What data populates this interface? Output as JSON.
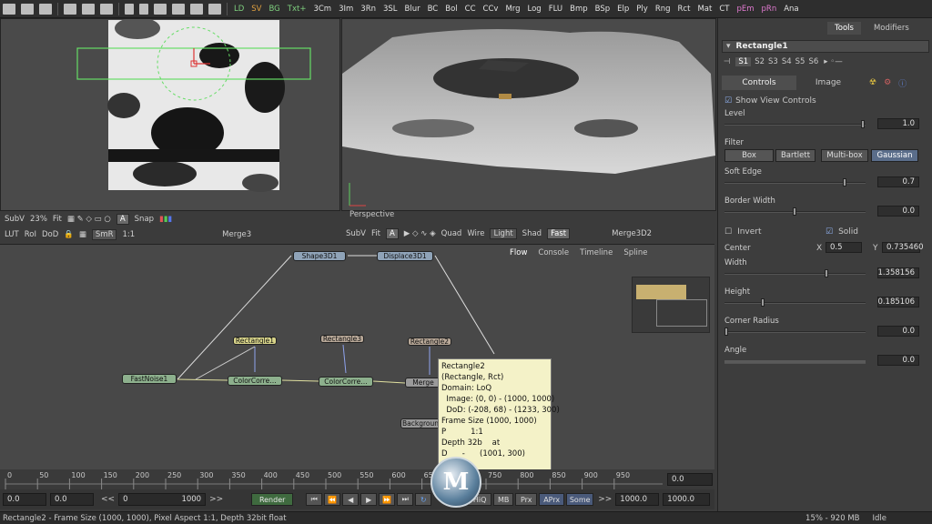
{
  "toolbar": {
    "buttons": [
      "LD",
      "SV",
      "BG",
      "Txt+",
      "3Cm",
      "3Im",
      "3Rn",
      "3SL",
      "Blur",
      "BC",
      "Bol",
      "CC",
      "CCv",
      "Mrg",
      "Log",
      "FLU",
      "Bmp",
      "BSp",
      "Elp",
      "Ply",
      "Rng",
      "Rct",
      "Mat",
      "CT",
      "pEm",
      "pRn",
      "Ana"
    ]
  },
  "viewer_left": {
    "subv": "SubV",
    "zoom": "23%",
    "fit": "Fit",
    "snap": "Snap",
    "lut": "LUT",
    "roi": "RoI",
    "dod": "DoD",
    "smr": "SmR",
    "ratio": "1:1",
    "title": "Merge3"
  },
  "viewer_right": {
    "perspective_label": "Perspective",
    "subv": "SubV",
    "fit": "Fit",
    "quad": "Quad",
    "wire": "Wire",
    "light": "Light",
    "shad": "Shad",
    "fast": "Fast",
    "title": "Merge3D2"
  },
  "flow": {
    "tabs": [
      "Flow",
      "Console",
      "Timeline",
      "Spline"
    ],
    "nodes": {
      "shape3d": "Shape3D1",
      "displace3d": "Displace3D1",
      "rect1": "Rectangle1",
      "rect3": "Rectangle3",
      "rect2": "Rectangle2",
      "fastnoise": "FastNoise1",
      "cc1": "ColorCorre…",
      "cc2": "ColorCorre…",
      "merge": "Merge",
      "background": "Backgroun"
    }
  },
  "tooltip": {
    "lines": [
      "Rectangle2",
      "(Rectangle, Rct)",
      "",
      "Domain: LoQ",
      "  Image: (0, 0) - (1000, 1000)",
      "  DoD: (-208, 68) - (1233, 300)",
      "",
      "Frame Size (1000, 1000)",
      "P          1:1",
      "Depth 32b    at",
      "D      -      (1001, 300)"
    ]
  },
  "timeline": {
    "ticks": [
      "0",
      "50",
      "100",
      "150",
      "200",
      "250",
      "300",
      "350",
      "400",
      "450",
      "500",
      "550",
      "600",
      "650",
      "700",
      "750",
      "800",
      "850",
      "900",
      "950"
    ],
    "end_value": "0.0"
  },
  "transport": {
    "start": "0.0",
    "current": "0.0",
    "range_start": "0",
    "range_end": "1000",
    "render": "Render",
    "hiq": "HiQ",
    "mb": "MB",
    "prx": "Prx",
    "aprx": "APrx",
    "some": "Some",
    "end": "1000.0",
    "end2": "1000.0"
  },
  "status": {
    "text": "Rectangle2 - Frame Size (1000, 1000), Pixel Aspect 1:1, Depth 32bit float",
    "memory": "15% - 920 MB",
    "state": "Idle"
  },
  "panel": {
    "tabs": [
      "Tools",
      "Modifiers"
    ],
    "tool_name": "Rectangle1",
    "slots": [
      "S1",
      "S2",
      "S3",
      "S4",
      "S5",
      "S6"
    ],
    "subtabs": [
      "Controls",
      "Image"
    ],
    "show_view_controls": "Show View Controls",
    "level": {
      "label": "Level",
      "value": "1.0"
    },
    "filter": {
      "label": "Filter",
      "options": [
        "Box",
        "Bartlett",
        "Multi-box",
        "Gaussian"
      ],
      "selected": "Gaussian"
    },
    "soft_edge": {
      "label": "Soft Edge",
      "value": "0.7"
    },
    "border_width": {
      "label": "Border Width",
      "value": "0.0"
    },
    "invert": "Invert",
    "solid": "Solid",
    "center": {
      "label": "Center",
      "x_label": "X",
      "x": "0.5",
      "y_label": "Y",
      "y": "0.735460"
    },
    "width": {
      "label": "Width",
      "value": "1.358156"
    },
    "height": {
      "label": "Height",
      "value": "0.185106"
    },
    "corner_radius": {
      "label": "Corner Radius",
      "value": "0.0"
    },
    "angle": {
      "label": "Angle",
      "value": "0.0"
    }
  },
  "watermark": "M"
}
